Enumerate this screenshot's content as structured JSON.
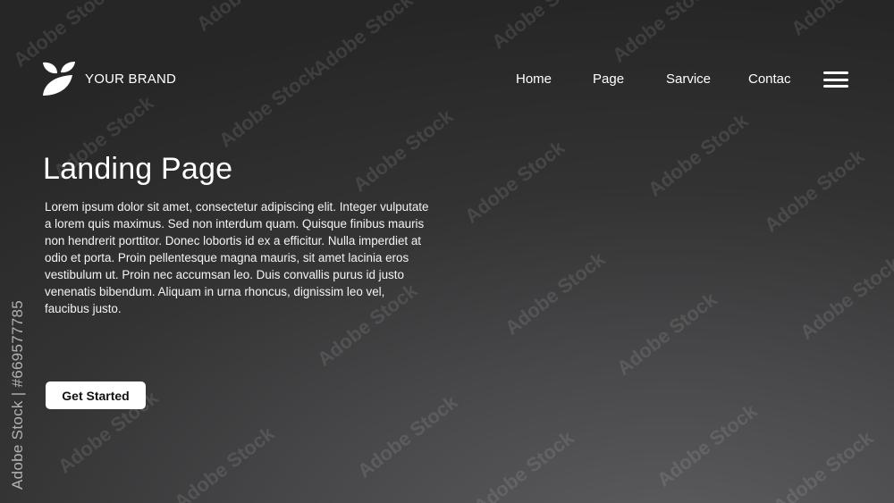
{
  "header": {
    "brand_name": "YOUR BRAND",
    "logo_icon": "leaf-icon",
    "nav": [
      {
        "label": "Home"
      },
      {
        "label": "Page"
      },
      {
        "label": "Sarvice"
      },
      {
        "label": "Contac"
      }
    ],
    "menu_icon": "hamburger-menu-icon"
  },
  "hero": {
    "title": "Landing Page",
    "paragraph": "Lorem ipsum dolor sit amet, consectetur adipiscing elit. Integer vulputate a lorem quis maximus. Sed non interdum quam. Quisque finibus mauris non hendrerit porttitor. Donec lobortis id ex a efficitur. Nulla imperdiet at odio et porta. Proin pellentesque magna mauris, sit amet lacinia eros vestibulum ut. Proin nec accumsan leo. Duis convallis purus id justo venenatis bibendum. Aliquam in urna rhoncus, dignissim leo vel, faucibus justo.",
    "cta_label": "Get Started"
  },
  "watermark": {
    "text": "Adobe Stock",
    "id_text": "Adobe Stock | #669577785"
  },
  "colors": {
    "background_dark": "#262626",
    "background_light": "#5e5e60",
    "text": "#ffffff",
    "button_bg": "#ffffff",
    "button_text": "#111111"
  }
}
